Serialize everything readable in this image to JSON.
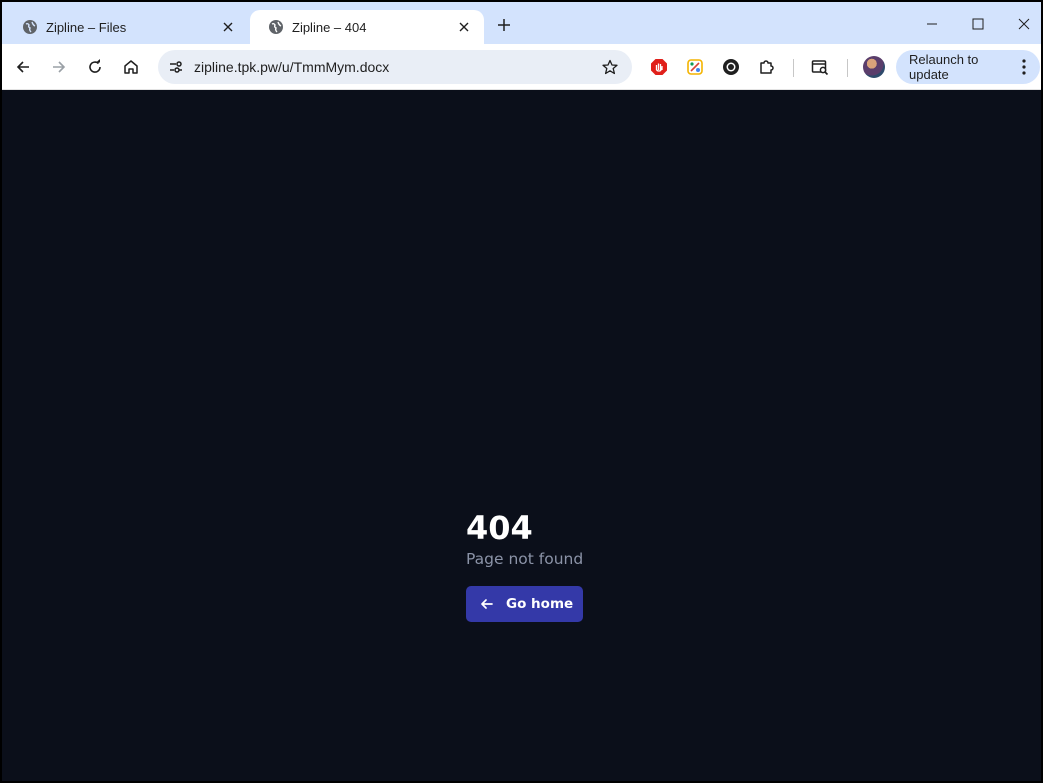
{
  "browser": {
    "tabs": [
      {
        "title": "Zipline – Files",
        "active": false,
        "favicon": "globe-icon"
      },
      {
        "title": "Zipline – 404",
        "active": true,
        "favicon": "globe-icon"
      }
    ],
    "address": {
      "url": "zipline.tpk.pw/u/TmmMym.docx"
    },
    "relaunch_label": "Relaunch to update",
    "colors": {
      "tabstrip": "#d3e3fd",
      "toolbar": "#ffffff",
      "omnibox": "#e9eef6"
    }
  },
  "page": {
    "error_code": "404",
    "error_message": "Page not found",
    "home_button_label": "Go home",
    "colors": {
      "background": "#0b0f1a",
      "button": "#3439a8",
      "message": "#8b93a7"
    }
  }
}
